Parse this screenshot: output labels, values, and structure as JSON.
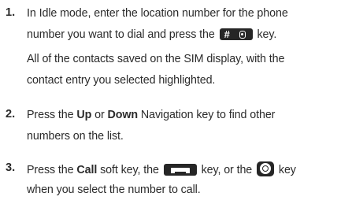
{
  "steps": [
    {
      "number": "1.",
      "line1_a": "In Idle mode, enter the location number for the phone",
      "line2_a": "number you want to dial and press the",
      "line2_b": "key.",
      "line3": "All of the contacts saved on the SIM display, with the",
      "line4": "contact entry you selected highlighted."
    },
    {
      "number": "2.",
      "line1_a": "Press the",
      "bold1": "Up",
      "line1_b": "or",
      "bold2": "Down",
      "line1_c": "Navigation key to find other",
      "line2": "numbers on the list."
    },
    {
      "number": "3.",
      "line1_a": "Press the",
      "bold1": "Call",
      "line1_b": "soft key, the",
      "line1_c": "key, or the",
      "line1_d": "key",
      "line2": "when you select the number to call."
    }
  ],
  "key_icons": {
    "hash_key_label": "#",
    "hash_key_icon": "phonebook-icon",
    "send_key_icon": "send-handset-icon",
    "round_key_icon": "menu-select-icon"
  }
}
